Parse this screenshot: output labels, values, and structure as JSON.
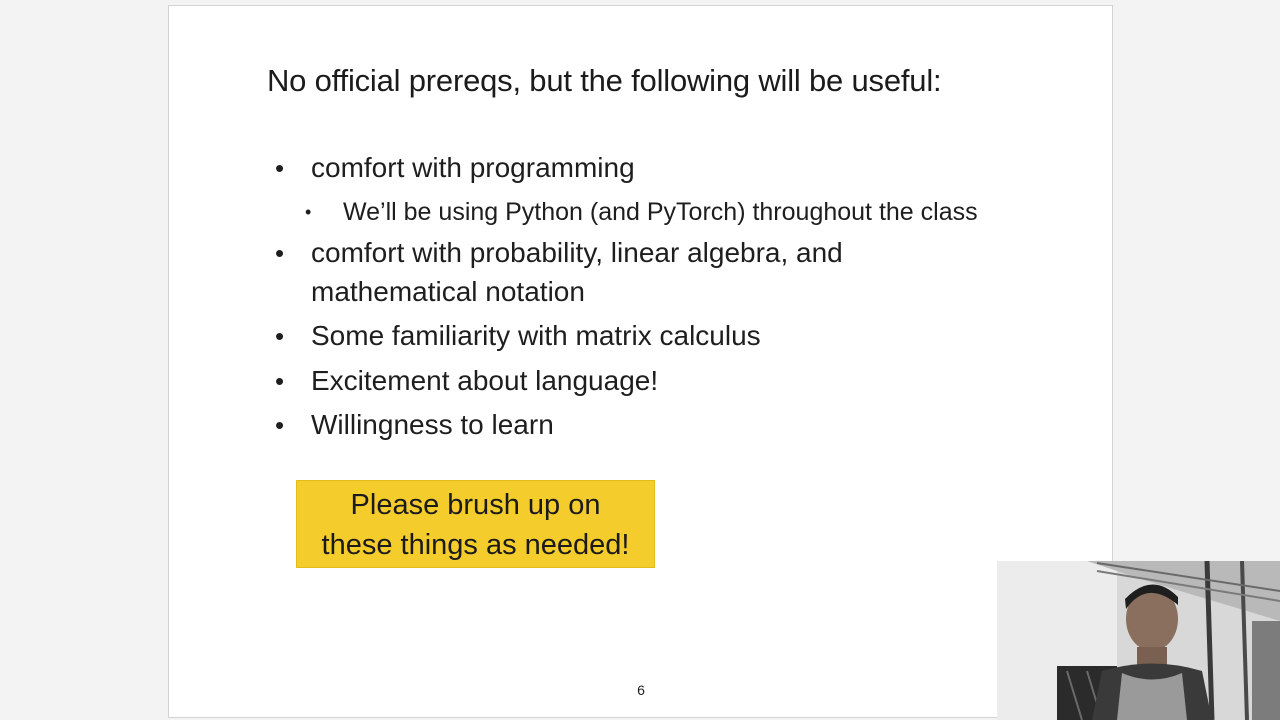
{
  "slide": {
    "title": "No official prereqs, but the following will be useful:",
    "bullets": [
      {
        "text": "comfort with programming",
        "sub": "We’ll be using Python (and PyTorch) throughout the class"
      },
      {
        "line1": "comfort with probability, linear algebra, and",
        "line2": "mathematical notation"
      },
      {
        "text": "Some familiarity with matrix calculus"
      },
      {
        "text": "Excitement about language!"
      },
      {
        "text": "Willingness to learn"
      }
    ],
    "bullet_glyph": "•",
    "callout": {
      "line1": "Please brush up on",
      "line2": "these things as needed!",
      "color": "#f4cc2c"
    },
    "page_number": "6"
  },
  "webcam": {
    "icon": "person-video-feed"
  }
}
